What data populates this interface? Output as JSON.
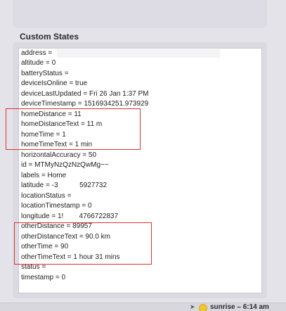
{
  "custom_states": {
    "title": "Custom States",
    "items": [
      "address =",
      "altitude = 0",
      "batteryStatus =",
      "deviceIsOnline = true",
      "deviceLastUpdated = Fri 26 Jan 1:37 PM",
      "deviceTimestamp = 1516934251.973929",
      "homeDistance = 11",
      "homeDistanceText = 11 m",
      "homeTime = 1",
      "homeTimeText = 1 min",
      "horizontalAccuracy = 50",
      "id = MTMyNzQzNzQwMg~~",
      "labels = Home",
      "latitude = -3           5927732",
      "locationStatus =",
      "locationTimestamp = 0",
      "longitude = 1!        4766722837",
      "otherDistance = 89957",
      "otherDistanceText = 90.0 km",
      "otherTime = 90",
      "otherTimeText = 1 hour 31 mins",
      "status =",
      "timestamp = 0"
    ]
  },
  "status_bar": {
    "text": "sunrise – 6:14 am"
  },
  "colors": {
    "highlight": "#e03030",
    "panel": "#dbdae0",
    "list_bg": "#ffffff"
  }
}
